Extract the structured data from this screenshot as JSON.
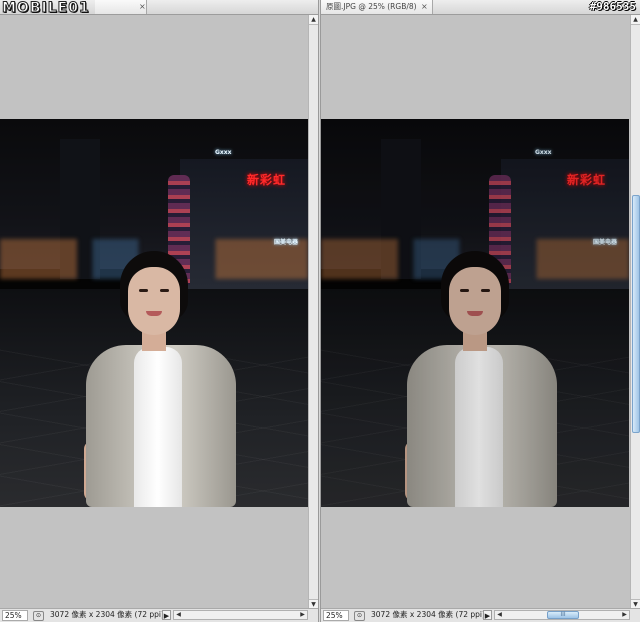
{
  "watermark": {
    "logo_text": "MOBILE01",
    "tag": "#986535"
  },
  "left_doc": {
    "tab_title": "",
    "status_zoom": "25%",
    "status_info": "3072 像素 x 2304 像素 (72 ppi)",
    "vscroll_position": 0.0
  },
  "right_doc": {
    "tab_title": "原圖.JPG @ 25% (RGB/8)",
    "status_zoom": "25%",
    "status_info": "3072 像素 x 2304 像素 (72 ppi)",
    "hscroll_grip": "III",
    "vscroll_position": 0.5
  },
  "photo": {
    "neon_sign": "新彩虹",
    "building_sign": "Gxxx",
    "building_sign_2": "国美电器"
  },
  "icons": {
    "close": "×",
    "play": "▶",
    "arrow_up": "▲",
    "arrow_down": "▼",
    "arrow_left": "◀",
    "arrow_right": "▶"
  }
}
